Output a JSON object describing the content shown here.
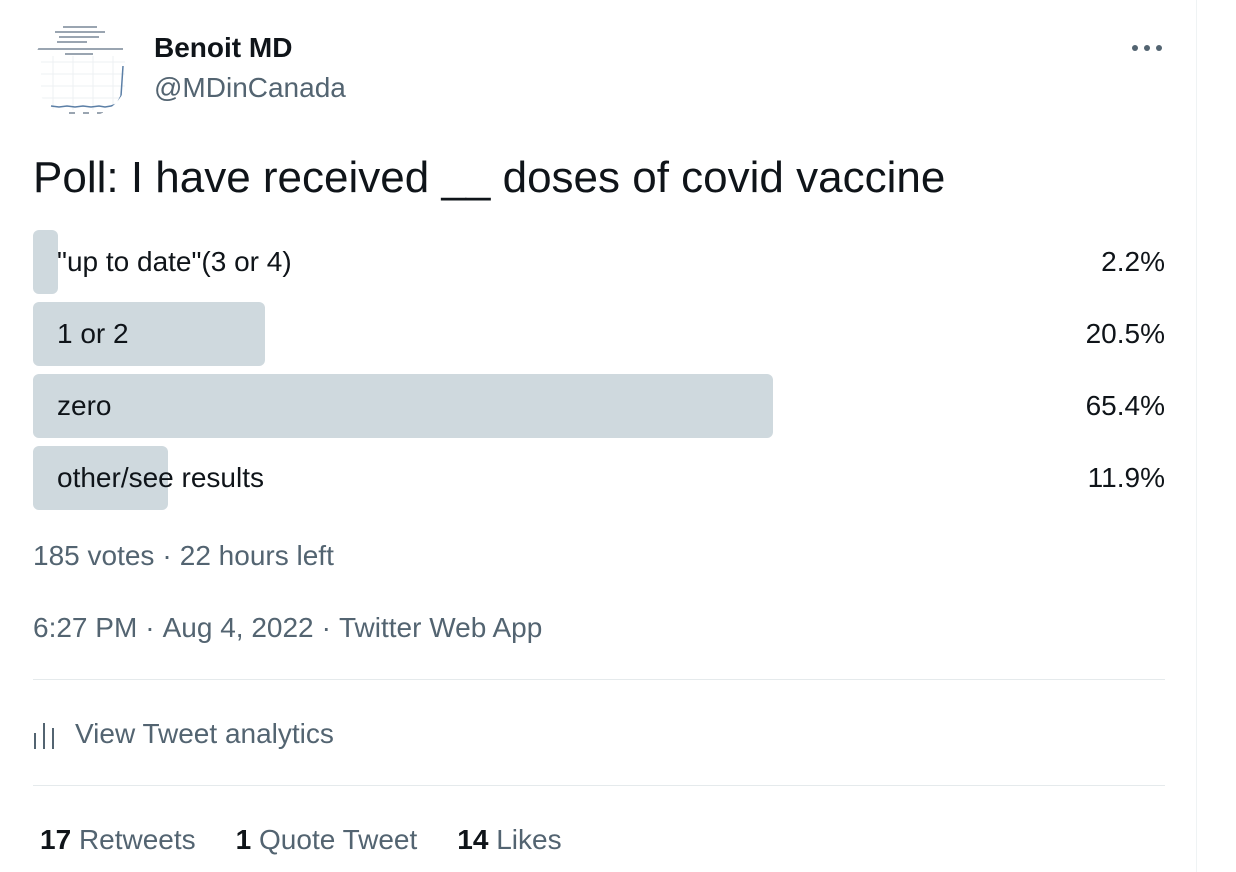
{
  "author": {
    "display_name": "Benoit MD",
    "handle": "@MDinCanada"
  },
  "tweet": {
    "text": "Poll: I have received __ doses of covid vaccine"
  },
  "poll": {
    "options": [
      {
        "label": "\"up to date\"(3 or 4)",
        "percent_label": "2.2%",
        "percent": 2.2
      },
      {
        "label": "1 or 2",
        "percent_label": "20.5%",
        "percent": 20.5
      },
      {
        "label": "zero",
        "percent_label": "65.4%",
        "percent": 65.4
      },
      {
        "label": "other/see results",
        "percent_label": "11.9%",
        "percent": 11.9
      }
    ],
    "votes": "185 votes",
    "time_left": "22 hours left"
  },
  "meta": {
    "time": "6:27 PM",
    "date": "Aug 4, 2022",
    "source": "Twitter Web App",
    "separator": "·"
  },
  "analytics": {
    "label": "View Tweet analytics",
    "icon": "analytics-bars-icon"
  },
  "stats": {
    "retweets": {
      "count": "17",
      "label": "Retweets"
    },
    "quotes": {
      "count": "1",
      "label": "Quote Tweet"
    },
    "likes": {
      "count": "14",
      "label": "Likes"
    }
  },
  "colors": {
    "text": "#0f1419",
    "secondary": "#536471",
    "poll_bar": "#cfd9de",
    "divider": "#e5eaec"
  }
}
